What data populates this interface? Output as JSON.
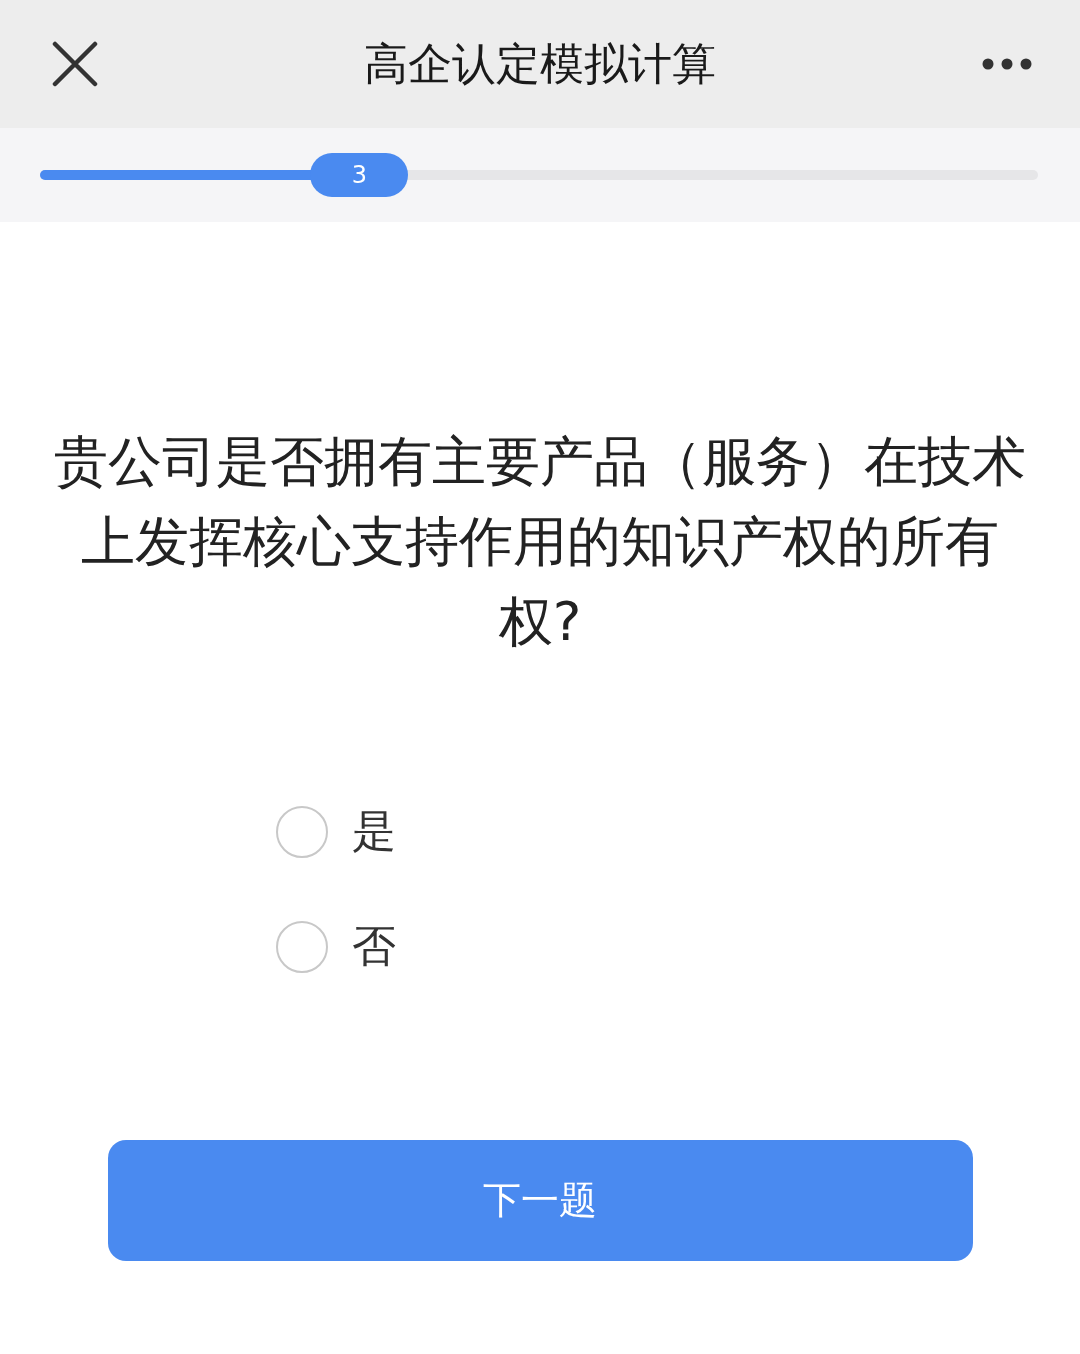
{
  "header": {
    "title": "高企认定模拟计算"
  },
  "progress": {
    "level": 0.32,
    "step": "3"
  },
  "question": "贵公司是否拥有主要产品（服务）在技术上发挥核心支持作用的知识产权的所有权?",
  "options": [
    {
      "label": "是",
      "selected": false
    },
    {
      "label": "否",
      "selected": false
    }
  ],
  "next_button": "下一题"
}
